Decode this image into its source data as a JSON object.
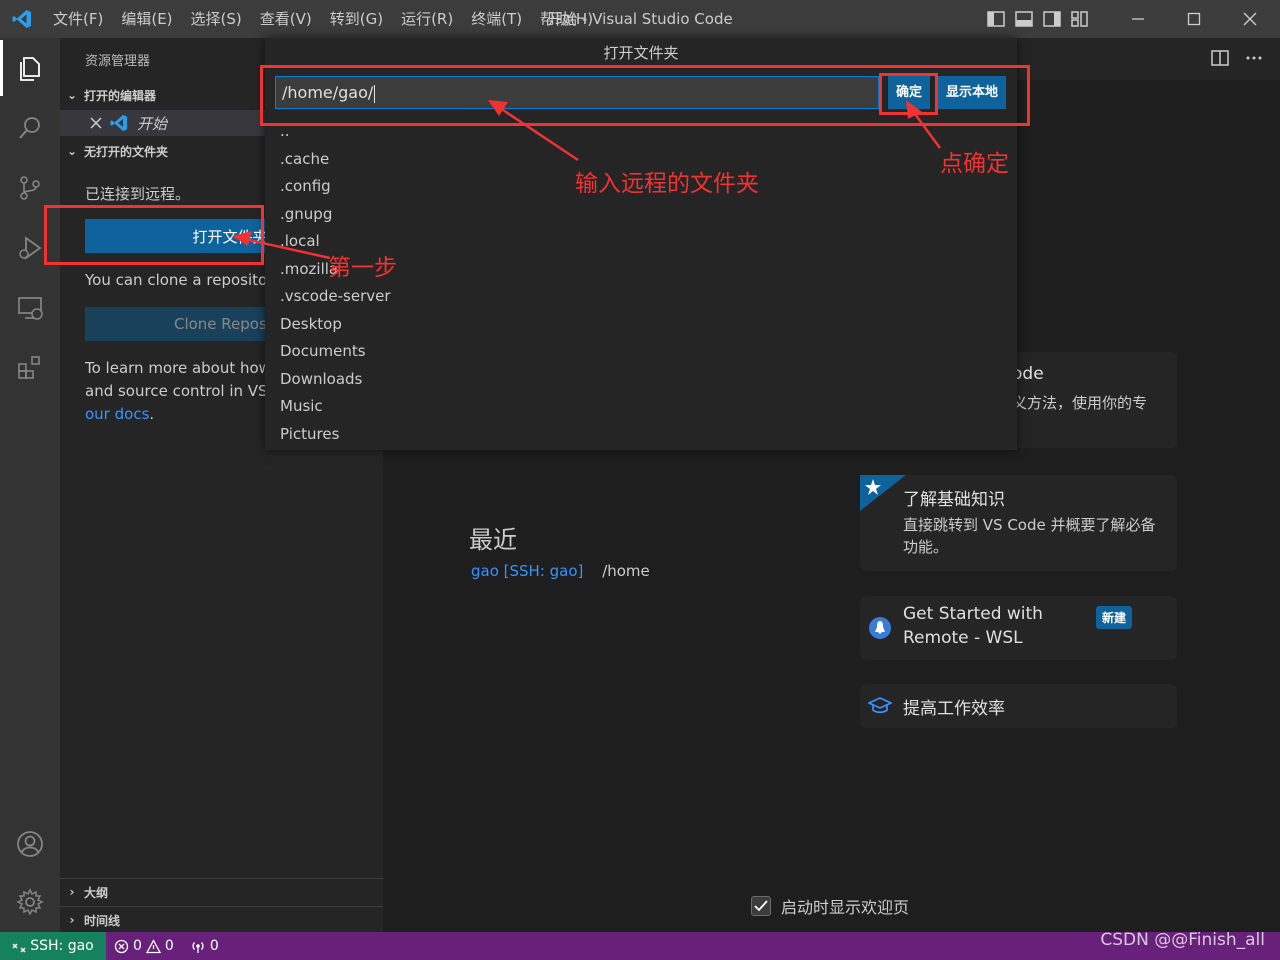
{
  "titlebar": {
    "menu": [
      "文件(F)",
      "编辑(E)",
      "选择(S)",
      "查看(V)",
      "转到(G)",
      "运行(R)",
      "终端(T)",
      "帮助(H)"
    ],
    "title": "开始 - Visual Studio Code"
  },
  "sidebar": {
    "title": "资源管理器",
    "open_editors_label": "打开的编辑器",
    "open_editor_item": "开始",
    "no_folder_label": "无打开的文件夹",
    "connected_text": "已连接到远程。",
    "open_folder_button": "打开文件夹",
    "clone_text": "You can clone a repositor",
    "clone_button": "Clone Reposito",
    "learn_line1": "To learn more about how",
    "learn_line2": "and source control in VS",
    "learn_link": "our docs",
    "learn_period": ".",
    "outline_label": "大纲",
    "timeline_label": "时间线"
  },
  "quick_input": {
    "title": "打开文件夹",
    "value": "/home/gao/",
    "ok_button": "确定",
    "show_local_button": "显示本地",
    "items": [
      "..",
      ".cache",
      ".config",
      ".gnupg",
      ".local",
      ".mozilla",
      ".vscode-server",
      "Desktop",
      "Documents",
      "Downloads",
      "Music",
      "Pictures"
    ]
  },
  "welcome": {
    "card1_title_partial": "ode",
    "card1_desc_partial": "义方法，使用你的专",
    "card2_title": "了解基础知识",
    "card2_desc_line1": "直接跳转到 VS Code 并概要了解必备",
    "card2_desc_line2": "功能。",
    "card3_title_line1": "Get Started with",
    "card3_title_line2": "Remote - WSL",
    "card3_badge": "新建",
    "card4_title": "提高工作效率",
    "recent_title": "最近",
    "recent_link": "gao [SSH: gao]",
    "recent_path": "/home",
    "show_on_startup": "启动时显示欢迎页"
  },
  "annotations": {
    "step1": "第一步",
    "input_hint": "输入远程的文件夹",
    "click_ok": "点确定"
  },
  "statusbar": {
    "remote": "SSH: gao",
    "errors": "0",
    "warnings": "0",
    "ports": "0"
  },
  "watermark": "CSDN @@Finish_all",
  "colors": {
    "annotation_red": "#f03232",
    "accent_blue": "#0e639c",
    "statusbar_purple": "#68217a",
    "remote_green": "#16825d"
  }
}
